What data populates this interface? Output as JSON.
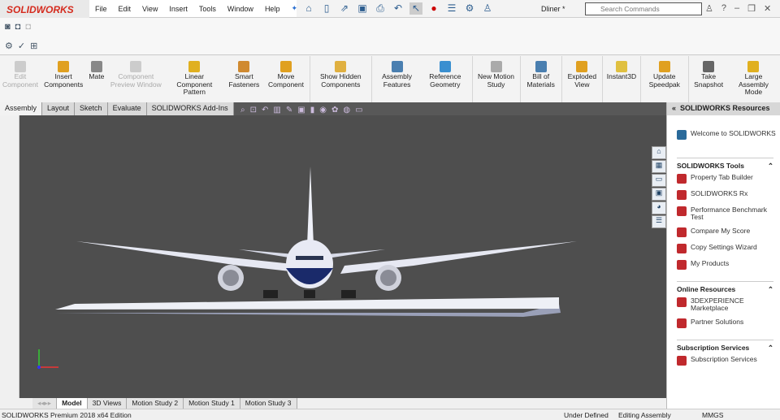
{
  "app": {
    "logo": "SOLIDWORKS",
    "document_title": "Dliner *"
  },
  "menu": [
    "File",
    "Edit",
    "View",
    "Insert",
    "Tools",
    "Window",
    "Help"
  ],
  "search": {
    "placeholder": "Search Commands"
  },
  "command_manager": [
    {
      "label": "Edit Component",
      "disabled": true,
      "color": "#cccccc"
    },
    {
      "label": "Insert Components",
      "color": "#e0a020"
    },
    {
      "label": "Mate",
      "color": "#888888"
    },
    {
      "label": "Component Preview Window",
      "disabled": true,
      "color": "#cccccc"
    },
    {
      "label": "Linear Component Pattern",
      "color": "#e0b020"
    },
    {
      "label": "Smart Fasteners",
      "color": "#d08a30"
    },
    {
      "label": "Move Component",
      "color": "#e0a020"
    },
    {
      "label": "Show Hidden Components",
      "color": "#e0b040"
    },
    {
      "label": "Assembly Features",
      "color": "#4a7fb0"
    },
    {
      "label": "Reference Geometry",
      "color": "#3a8fd0"
    },
    {
      "label": "New Motion Study",
      "color": "#aaaaaa"
    },
    {
      "label": "Bill of Materials",
      "color": "#4a7fb0"
    },
    {
      "label": "Exploded View",
      "color": "#e0a020"
    },
    {
      "label": "Instant3D",
      "color": "#e0c040"
    },
    {
      "label": "Update Speedpak",
      "color": "#e0a020"
    },
    {
      "label": "Take Snapshot",
      "color": "#666666"
    },
    {
      "label": "Large Assembly Mode",
      "color": "#e0b020"
    }
  ],
  "tabs": [
    "Assembly",
    "Layout",
    "Sketch",
    "Evaluate",
    "SOLIDWORKS Add-Ins"
  ],
  "resources": {
    "title": "SOLIDWORKS Resources",
    "welcome": "Welcome to SOLIDWORKS",
    "sections": [
      {
        "title": "SOLIDWORKS Tools",
        "items": [
          "Property Tab Builder",
          "SOLIDWORKS Rx",
          "Performance Benchmark Test",
          "Compare My Score",
          "Copy Settings Wizard",
          "My Products"
        ]
      },
      {
        "title": "Online Resources",
        "items": [
          "3DEXPERIENCE Marketplace",
          "Partner Solutions"
        ]
      },
      {
        "title": "Subscription Services",
        "items": [
          "Subscription Services"
        ]
      }
    ]
  },
  "bottom_tabs": [
    "Model",
    "3D Views",
    "Motion Study 2",
    "Motion Study 1",
    "Motion Study 3"
  ],
  "status": {
    "edition": "SOLIDWORKS Premium 2018 x64 Edition",
    "state": "Under Defined",
    "mode": "Editing Assembly",
    "units": "MMGS"
  }
}
